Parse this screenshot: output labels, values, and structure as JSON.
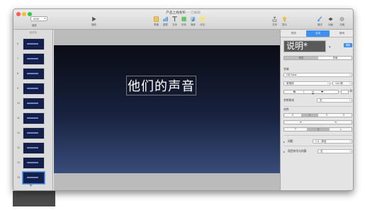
{
  "window": {
    "title": "产品上线发布",
    "title_suffix": "已编辑",
    "title_sep": " — "
  },
  "toolbar": {
    "zoom_value": "41%",
    "zoom_label": "缩放",
    "play_label": "播放",
    "insert_buttons": [
      "表格",
      "图表",
      "文本",
      "形状",
      "媒体",
      "评论"
    ],
    "share_label": "共享",
    "tips_label": "提示",
    "format_label": "格式",
    "animate_label": "动画",
    "document_label": "文稿"
  },
  "navigator": {
    "label": "幻灯片",
    "slide_numbers": [
      "6",
      "7",
      "8",
      "9",
      "10",
      "11",
      "12",
      "13",
      "14",
      "15"
    ],
    "selected_index": 9,
    "add_label": "+"
  },
  "slide": {
    "main_text": "他们的声音"
  },
  "inspector": {
    "tabs": [
      "样式",
      "文本",
      "排列"
    ],
    "active_tab": 1,
    "style_preview": "说明*",
    "update_label": "更新",
    "segments": [
      "样式",
      "布局"
    ],
    "font_section": "字体",
    "font_name": "Gill Sans",
    "font_weight": "常规体",
    "font_size": "144 磅",
    "bold_label": "B",
    "italic_label": "I",
    "underline_label": "U",
    "strike_label": "S",
    "char_style_label": "字符样式",
    "char_style_value": "无",
    "align_section": "对齐",
    "spacing_label": "间距",
    "spacing_value": "1.0 - 单倍",
    "bullets_label": "项目符号与列表",
    "bullets_value": "无"
  },
  "colors": {
    "accent": "#3f8ff0",
    "slide_top": "#0a0c14",
    "slide_bottom": "#384d7a"
  }
}
